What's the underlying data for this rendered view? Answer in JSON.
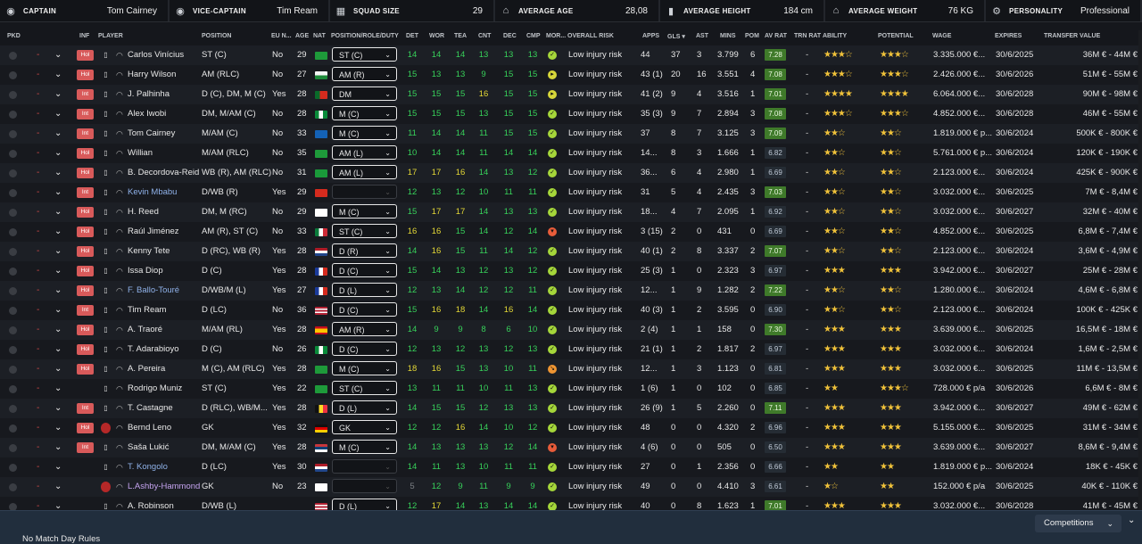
{
  "stats": [
    {
      "icon": "captain-icon",
      "label": "CAPTAIN",
      "value": "Tom Cairney"
    },
    {
      "icon": "vice-captain-icon",
      "label": "VICE-CAPTAIN",
      "value": "Tim Ream"
    },
    {
      "icon": "squad-size-icon",
      "label": "SQUAD SIZE",
      "value": "29"
    },
    {
      "icon": "average-age-icon",
      "label": "AVERAGE AGE",
      "value": "28,08"
    },
    {
      "icon": "average-height-icon",
      "label": "AVERAGE HEIGHT",
      "value": "184 cm"
    },
    {
      "icon": "average-weight-icon",
      "label": "AVERAGE WEIGHT",
      "value": "76 KG"
    },
    {
      "icon": "personality-icon",
      "label": "PERSONALITY",
      "value": "Professional"
    }
  ],
  "columns": {
    "pkd": "PKD",
    "inf": "INF",
    "player": "PLAYER",
    "position": "POSITION",
    "eu": "EU N...",
    "age": "AGE",
    "nat": "NAT",
    "role": "POSITION/ROLE/DUTY",
    "det": "DET",
    "wor": "WOR",
    "tea": "TEA",
    "cnt": "CNT",
    "dec": "DEC",
    "cmp": "CMP",
    "mor": "MOR...",
    "risk": "OVERALL RISK",
    "apps": "APPS",
    "gls": "GLS ▾",
    "ast": "AST",
    "mins": "MINS",
    "pom": "POM",
    "avrat": "AV RAT",
    "trn": "TRN RAT",
    "abil": "ABILITY",
    "pot": "POTENTIAL",
    "wage": "WAGE",
    "exp": "EXPIRES",
    "tv": "TRANSFER VALUE"
  },
  "colors": {
    "attr_green": "#37d15a",
    "attr_yellow": "#e4d836",
    "attr_orange": "#ef8c32",
    "badge_red": "#d85a5a",
    "rating_high": "#3f7a2a",
    "star": "#f0c23a"
  },
  "players": [
    {
      "inf": "Hol",
      "name": "Carlos Vinícius",
      "pos": "ST (C)",
      "eu": "No",
      "age": "29",
      "nat": "brazil-flag",
      "role": "ST (C)",
      "det": "14",
      "wor": "14",
      "tea": "14",
      "cnt": "13",
      "dec": "13",
      "cmp": "13",
      "mor": "ok",
      "risk": "Low injury risk",
      "apps": "44",
      "gls": "37",
      "ast": "3",
      "mins": "3.799",
      "pom": "6",
      "avrat": "7.28",
      "trn": "-",
      "abil": "★★★☆",
      "pot": "★★★☆",
      "wage": "3.335.000 €...",
      "exp": "30/6/2025",
      "tv": "36M € - 44M €"
    },
    {
      "inf": "Hol",
      "name": "Harry Wilson",
      "pos": "AM (RLC)",
      "eu": "No",
      "age": "27",
      "nat": "wales-flag",
      "role": "AM (R)",
      "det": "15",
      "wor": "13",
      "tea": "13",
      "cnt": "9",
      "dec": "15",
      "cmp": "15",
      "mor": "good",
      "risk": "Low injury risk",
      "apps": "43 (1)",
      "gls": "20",
      "ast": "16",
      "mins": "3.551",
      "pom": "4",
      "avrat": "7.08",
      "trn": "-",
      "abil": "★★★☆",
      "pot": "★★★☆",
      "wage": "2.426.000 €...",
      "exp": "30/6/2026",
      "tv": "51M € - 55M €"
    },
    {
      "inf": "Int",
      "name": "J. Palhinha",
      "pos": "D (C), DM, M (C)",
      "eu": "Yes",
      "age": "28",
      "nat": "portugal-flag",
      "role": "DM",
      "det": "15",
      "wor": "15",
      "tea": "15",
      "cnt": "16",
      "dec": "15",
      "cmp": "15",
      "mor": "good",
      "risk": "Low injury risk",
      "apps": "41 (2)",
      "gls": "9",
      "ast": "4",
      "mins": "3.516",
      "pom": "1",
      "avrat": "7.01",
      "trn": "-",
      "abil": "★★★★",
      "pot": "★★★★",
      "wage": "6.064.000 €...",
      "exp": "30/6/2028",
      "tv": "90M € - 98M €"
    },
    {
      "inf": "Int",
      "name": "Alex Iwobi",
      "pos": "DM, M/AM (C)",
      "eu": "No",
      "age": "28",
      "nat": "nigeria-flag",
      "role": "M (C)",
      "det": "15",
      "wor": "15",
      "tea": "15",
      "cnt": "13",
      "dec": "15",
      "cmp": "15",
      "mor": "ok",
      "risk": "Low injury risk",
      "apps": "35 (3)",
      "gls": "9",
      "ast": "7",
      "mins": "2.894",
      "pom": "3",
      "avrat": "7.08",
      "trn": "-",
      "abil": "★★★☆",
      "pot": "★★★☆",
      "wage": "4.852.000 €...",
      "exp": "30/6/2028",
      "tv": "46M € - 55M €"
    },
    {
      "inf": "Int",
      "name": "Tom Cairney",
      "pos": "M/AM (C)",
      "eu": "No",
      "age": "33",
      "nat": "scotland-flag",
      "role": "M (C)",
      "det": "11",
      "wor": "14",
      "tea": "14",
      "cnt": "11",
      "dec": "15",
      "cmp": "15",
      "mor": "ok",
      "risk": "Low injury risk",
      "apps": "37",
      "gls": "8",
      "ast": "7",
      "mins": "3.125",
      "pom": "3",
      "avrat": "7.09",
      "trn": "-",
      "abil": "★★☆",
      "pot": "★★☆",
      "wage": "1.819.000 € p...",
      "exp": "30/6/2024",
      "tv": "500K € - 800K €"
    },
    {
      "inf": "Hol",
      "name": "Willian",
      "pos": "M/AM (RLC)",
      "eu": "No",
      "age": "35",
      "nat": "brazil-flag",
      "role": "AM (L)",
      "det": "10",
      "wor": "14",
      "tea": "14",
      "cnt": "11",
      "dec": "14",
      "cmp": "14",
      "mor": "ok",
      "risk": "Low injury risk",
      "apps": "14...",
      "gls": "8",
      "ast": "3",
      "mins": "1.666",
      "pom": "1",
      "avrat": "6.82",
      "trn": "-",
      "abil": "★★☆",
      "pot": "★★☆",
      "wage": "5.761.000 € p...",
      "exp": "30/6/2024",
      "tv": "120K € - 190K €"
    },
    {
      "inf": "Hol",
      "name": "B. Decordova-Reid",
      "pos": "WB (R), AM (RLC)",
      "eu": "No",
      "age": "31",
      "nat": "jamaica-flag",
      "role": "AM (L)",
      "det": "17",
      "wor": "17",
      "tea": "16",
      "cnt": "14",
      "dec": "13",
      "cmp": "12",
      "mor": "ok",
      "risk": "Low injury risk",
      "apps": "36...",
      "gls": "6",
      "ast": "4",
      "mins": "2.980",
      "pom": "1",
      "avrat": "6.69",
      "trn": "-",
      "abil": "★★☆",
      "pot": "★★☆",
      "wage": "2.123.000 €...",
      "exp": "30/6/2024",
      "tv": "425K € - 900K €"
    },
    {
      "inf": "Int",
      "name": "Kevin Mbabu",
      "pos": "D/WB (R)",
      "eu": "Yes",
      "age": "29",
      "nat": "switzerland-flag",
      "role": "",
      "det": "12",
      "wor": "13",
      "tea": "12",
      "cnt": "10",
      "dec": "11",
      "cmp": "11",
      "mor": "ok",
      "risk": "Low injury risk",
      "apps": "31",
      "gls": "5",
      "ast": "4",
      "mins": "2.435",
      "pom": "3",
      "avrat": "7.03",
      "trn": "-",
      "abil": "★★☆",
      "pot": "★★☆",
      "wage": "3.032.000 €...",
      "exp": "30/6/2025",
      "tv": "7M € - 8,4M €"
    },
    {
      "inf": "Hol",
      "name": "H. Reed",
      "pos": "DM, M (RC)",
      "eu": "No",
      "age": "29",
      "nat": "england-flag",
      "role": "M (C)",
      "det": "15",
      "wor": "17",
      "tea": "17",
      "cnt": "14",
      "dec": "13",
      "cmp": "13",
      "mor": "ok",
      "risk": "Low injury risk",
      "apps": "18...",
      "gls": "4",
      "ast": "7",
      "mins": "2.095",
      "pom": "1",
      "avrat": "6.92",
      "trn": "-",
      "abil": "★★☆",
      "pot": "★★☆",
      "wage": "3.032.000 €...",
      "exp": "30/6/2027",
      "tv": "32M € - 40M €"
    },
    {
      "inf": "Hol",
      "name": "Raúl Jiménez",
      "pos": "AM (R), ST (C)",
      "eu": "No",
      "age": "33",
      "nat": "mexico-flag",
      "role": "ST (C)",
      "det": "16",
      "wor": "16",
      "tea": "15",
      "cnt": "14",
      "dec": "12",
      "cmp": "14",
      "mor": "bad",
      "risk": "Low injury risk",
      "apps": "3 (15)",
      "gls": "2",
      "ast": "0",
      "mins": "431",
      "pom": "0",
      "avrat": "6.69",
      "trn": "-",
      "abil": "★★☆",
      "pot": "★★☆",
      "wage": "4.852.000 €...",
      "exp": "30/6/2025",
      "tv": "6,8M € - 7,4M €"
    },
    {
      "inf": "Hol",
      "name": "Kenny Tete",
      "pos": "D (RC), WB (R)",
      "eu": "Yes",
      "age": "28",
      "nat": "netherlands-flag",
      "role": "D (R)",
      "det": "14",
      "wor": "16",
      "tea": "15",
      "cnt": "11",
      "dec": "14",
      "cmp": "12",
      "mor": "ok",
      "risk": "Low injury risk",
      "apps": "40 (1)",
      "gls": "2",
      "ast": "8",
      "mins": "3.337",
      "pom": "2",
      "avrat": "7.07",
      "trn": "-",
      "abil": "★★☆",
      "pot": "★★☆",
      "wage": "2.123.000 €...",
      "exp": "30/6/2024",
      "tv": "3,6M € - 4,9M €"
    },
    {
      "inf": "Hol",
      "name": "Issa Diop",
      "pos": "D (C)",
      "eu": "Yes",
      "age": "28",
      "nat": "france-flag",
      "role": "D (C)",
      "det": "15",
      "wor": "14",
      "tea": "13",
      "cnt": "12",
      "dec": "13",
      "cmp": "12",
      "mor": "ok",
      "risk": "Low injury risk",
      "apps": "25 (3)",
      "gls": "1",
      "ast": "0",
      "mins": "2.323",
      "pom": "3",
      "avrat": "6.97",
      "trn": "-",
      "abil": "★★★",
      "pot": "★★★",
      "wage": "3.942.000 €...",
      "exp": "30/6/2027",
      "tv": "25M € - 28M €"
    },
    {
      "inf": "Hol",
      "name": "F. Ballo-Touré",
      "pos": "D/WB/M (L)",
      "eu": "Yes",
      "age": "27",
      "nat": "france-flag",
      "role": "D (L)",
      "det": "12",
      "wor": "13",
      "tea": "14",
      "cnt": "12",
      "dec": "12",
      "cmp": "11",
      "mor": "ok",
      "risk": "Low injury risk",
      "apps": "12...",
      "gls": "1",
      "ast": "9",
      "mins": "1.282",
      "pom": "2",
      "avrat": "7.22",
      "trn": "-",
      "abil": "★★☆",
      "pot": "★★☆",
      "wage": "1.280.000 €...",
      "exp": "30/6/2024",
      "tv": "4,6M € - 6,8M €"
    },
    {
      "inf": "Int",
      "name": "Tim Ream",
      "pos": "D (LC)",
      "eu": "No",
      "age": "36",
      "nat": "usa-flag",
      "role": "D (C)",
      "det": "15",
      "wor": "16",
      "tea": "18",
      "cnt": "14",
      "dec": "16",
      "cmp": "14",
      "mor": "ok",
      "risk": "Low injury risk",
      "apps": "40 (3)",
      "gls": "1",
      "ast": "2",
      "mins": "3.595",
      "pom": "0",
      "avrat": "6.90",
      "trn": "-",
      "abil": "★★☆",
      "pot": "★★☆",
      "wage": "2.123.000 €...",
      "exp": "30/6/2024",
      "tv": "100K € - 425K €"
    },
    {
      "inf": "Hol",
      "name": "A. Traoré",
      "pos": "M/AM (RL)",
      "eu": "Yes",
      "age": "28",
      "nat": "spain-flag",
      "role": "AM (R)",
      "det": "14",
      "wor": "9",
      "tea": "9",
      "cnt": "8",
      "dec": "6",
      "cmp": "10",
      "mor": "ok",
      "risk": "Low injury risk",
      "apps": "2 (4)",
      "gls": "1",
      "ast": "1",
      "mins": "158",
      "pom": "0",
      "avrat": "7.30",
      "trn": "-",
      "abil": "★★★",
      "pot": "★★★",
      "wage": "3.639.000 €...",
      "exp": "30/6/2025",
      "tv": "16,5M € - 18M €"
    },
    {
      "inf": "Hol",
      "name": "T. Adarabioyo",
      "pos": "D (C)",
      "eu": "No",
      "age": "26",
      "nat": "nigeria-flag",
      "role": "D (C)",
      "det": "12",
      "wor": "13",
      "tea": "12",
      "cnt": "13",
      "dec": "12",
      "cmp": "13",
      "mor": "ok",
      "risk": "Low injury risk",
      "apps": "21 (1)",
      "gls": "1",
      "ast": "2",
      "mins": "1.817",
      "pom": "2",
      "avrat": "6.97",
      "trn": "-",
      "abil": "★★★",
      "pot": "★★★",
      "wage": "3.032.000 €...",
      "exp": "30/6/2024",
      "tv": "1,6M € - 2,5M €"
    },
    {
      "inf": "Hol",
      "name": "A. Pereira",
      "pos": "M (C), AM (RLC)",
      "eu": "Yes",
      "age": "28",
      "nat": "brazil-flag",
      "role": "M (C)",
      "det": "18",
      "wor": "16",
      "tea": "15",
      "cnt": "13",
      "dec": "10",
      "cmp": "11",
      "mor": "poor",
      "risk": "Low injury risk",
      "apps": "12...",
      "gls": "1",
      "ast": "3",
      "mins": "1.123",
      "pom": "0",
      "avrat": "6.81",
      "trn": "-",
      "abil": "★★★",
      "pot": "★★★",
      "wage": "3.032.000 €...",
      "exp": "30/6/2025",
      "tv": "11M € - 13,5M €"
    },
    {
      "inf": "",
      "name": "Rodrigo Muniz",
      "pos": "ST (C)",
      "eu": "Yes",
      "age": "22",
      "nat": "brazil-flag",
      "role": "ST (C)",
      "det": "13",
      "wor": "11",
      "tea": "11",
      "cnt": "10",
      "dec": "11",
      "cmp": "13",
      "mor": "ok",
      "risk": "Low injury risk",
      "apps": "1 (6)",
      "gls": "1",
      "ast": "0",
      "mins": "102",
      "pom": "0",
      "avrat": "6.85",
      "trn": "-",
      "abil": "★★",
      "pot": "★★★☆",
      "wage": "728.000 € p/a",
      "exp": "30/6/2026",
      "tv": "6,6M € - 8M €"
    },
    {
      "inf": "Int",
      "name": "T. Castagne",
      "pos": "D (RLC), WB/M...",
      "eu": "Yes",
      "age": "28",
      "nat": "belgium-flag",
      "role": "D (L)",
      "det": "14",
      "wor": "15",
      "tea": "15",
      "cnt": "12",
      "dec": "13",
      "cmp": "13",
      "mor": "ok",
      "risk": "Low injury risk",
      "apps": "26 (9)",
      "gls": "1",
      "ast": "5",
      "mins": "2.260",
      "pom": "0",
      "avrat": "7.11",
      "trn": "-",
      "abil": "★★★",
      "pot": "★★★",
      "wage": "3.942.000 €...",
      "exp": "30/6/2027",
      "tv": "49M € - 62M €"
    },
    {
      "inf": "Hol",
      "name": "Bernd Leno",
      "pos": "GK",
      "eu": "Yes",
      "age": "32",
      "nat": "germany-flag",
      "role": "GK",
      "det": "12",
      "wor": "12",
      "tea": "16",
      "cnt": "14",
      "dec": "10",
      "cmp": "12",
      "mor": "ok",
      "risk": "Low injury risk",
      "apps": "48",
      "gls": "0",
      "ast": "0",
      "mins": "4.320",
      "pom": "2",
      "avrat": "6.96",
      "trn": "-",
      "abil": "★★★",
      "pot": "★★★",
      "wage": "5.155.000 €...",
      "exp": "30/6/2025",
      "tv": "31M € - 34M €"
    },
    {
      "inf": "Int",
      "name": "Saša Lukić",
      "pos": "DM, M/AM (C)",
      "eu": "Yes",
      "age": "28",
      "nat": "serbia-flag",
      "role": "M (C)",
      "det": "14",
      "wor": "13",
      "tea": "13",
      "cnt": "13",
      "dec": "12",
      "cmp": "14",
      "mor": "bad",
      "risk": "Low injury risk",
      "apps": "4 (6)",
      "gls": "0",
      "ast": "0",
      "mins": "505",
      "pom": "0",
      "avrat": "6.50",
      "trn": "-",
      "abil": "★★★",
      "pot": "★★★",
      "wage": "3.639.000 €...",
      "exp": "30/6/2027",
      "tv": "8,6M € - 9,4M €"
    },
    {
      "inf": "",
      "name": "T. Kongolo",
      "pos": "D (LC)",
      "eu": "Yes",
      "age": "30",
      "nat": "netherlands-flag",
      "role": "",
      "det": "14",
      "wor": "11",
      "tea": "13",
      "cnt": "10",
      "dec": "11",
      "cmp": "11",
      "mor": "ok",
      "risk": "Low injury risk",
      "apps": "27",
      "gls": "0",
      "ast": "1",
      "mins": "2.356",
      "pom": "0",
      "avrat": "6.66",
      "trn": "-",
      "abil": "★★",
      "pot": "★★",
      "wage": "1.819.000 € p...",
      "exp": "30/6/2024",
      "tv": "18K € - 45K €"
    },
    {
      "inf": "",
      "name": "L.Ashby-Hammond",
      "pos": "GK",
      "eu": "No",
      "age": "23",
      "nat": "england-flag",
      "role": "",
      "det": "5",
      "wor": "12",
      "tea": "9",
      "cnt": "11",
      "dec": "9",
      "cmp": "9",
      "mor": "ok",
      "risk": "Low injury risk",
      "apps": "49",
      "gls": "0",
      "ast": "0",
      "mins": "4.410",
      "pom": "3",
      "avrat": "6.61",
      "trn": "-",
      "abil": "★☆",
      "pot": "★★",
      "wage": "152.000 € p/a",
      "exp": "30/6/2025",
      "tv": "40K € - 110K €"
    },
    {
      "inf": "",
      "name": "A. Robinson",
      "pos": "D/WB (L)",
      "eu": "",
      "age": "",
      "nat": "usa-flag",
      "role": "D (L)",
      "det": "12",
      "wor": "17",
      "tea": "14",
      "cnt": "13",
      "dec": "14",
      "cmp": "14",
      "mor": "ok",
      "risk": "Low injury risk",
      "apps": "40",
      "gls": "0",
      "ast": "8",
      "mins": "1.623",
      "pom": "1",
      "avrat": "7.01",
      "trn": "-",
      "abil": "★★★",
      "pot": "★★★",
      "wage": "3.032.000 €...",
      "exp": "30/6/2028",
      "tv": "41M € - 45M €"
    }
  ],
  "footer": {
    "rules_text": "No Match Day Rules",
    "competitions_label": "Competitions"
  }
}
